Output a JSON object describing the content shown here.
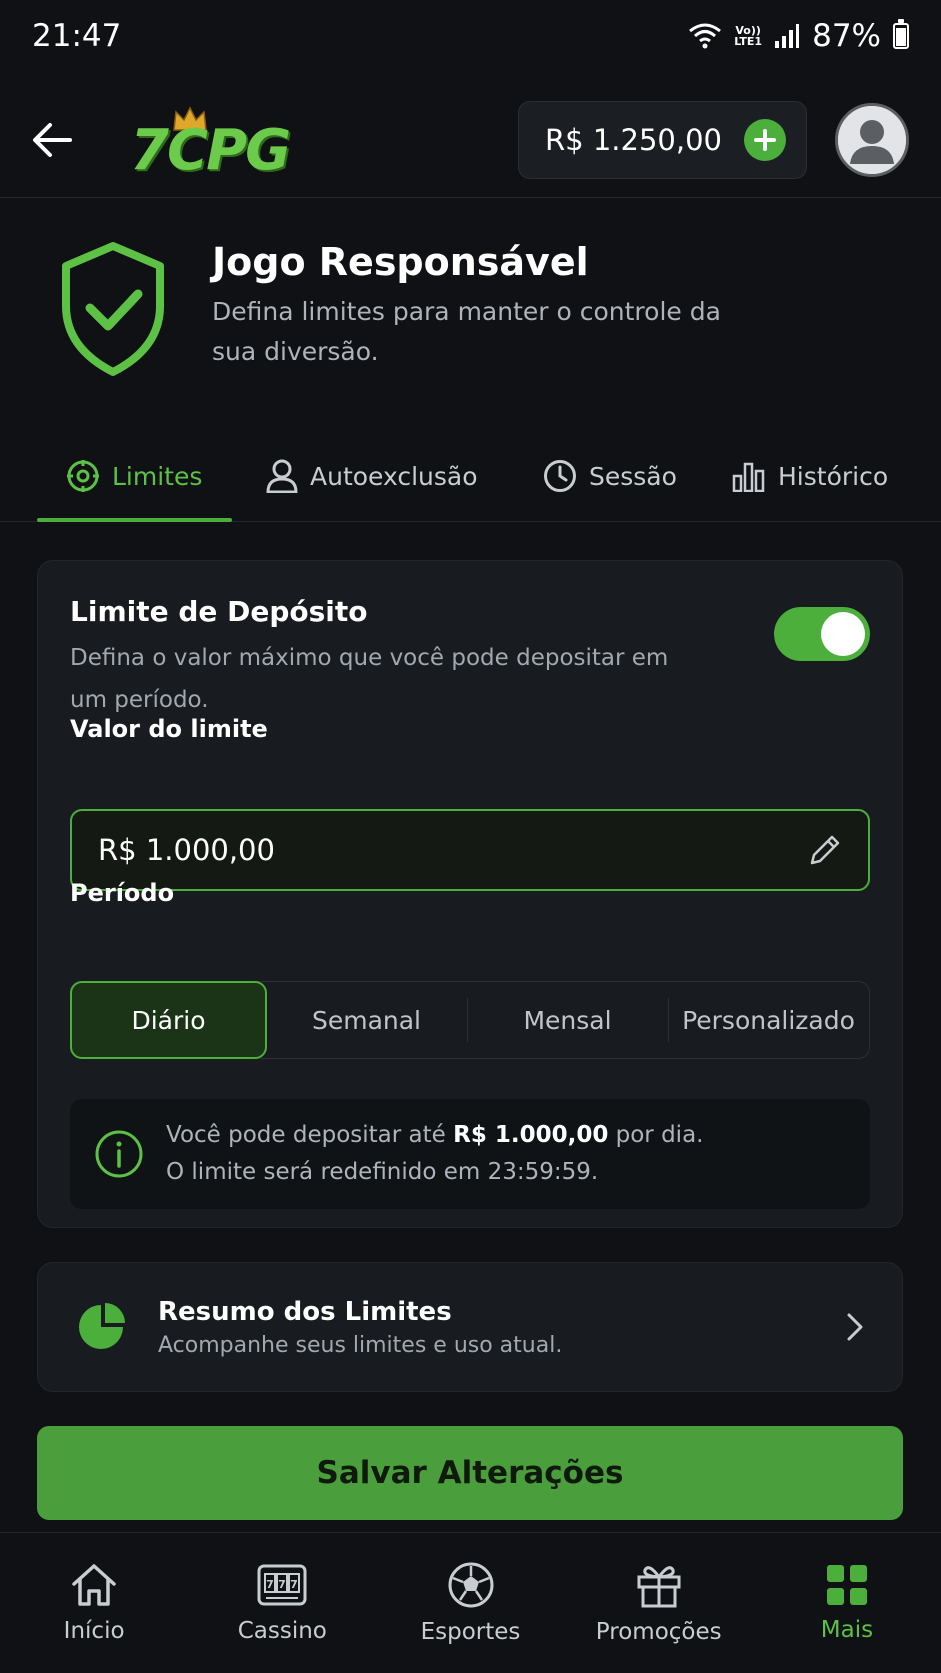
{
  "status_bar": {
    "time": "21:47",
    "network_top": "Vo))",
    "network_bottom": "LTE1",
    "battery": "87%"
  },
  "topbar": {
    "logo": "7CPG",
    "balance": "R$ 1.250,00"
  },
  "header": {
    "title": "Jogo Responsável",
    "subtitle": "Defina limites para manter o controle da sua diversão."
  },
  "tabs": [
    {
      "label": "Limites",
      "icon": "target-icon",
      "active": true
    },
    {
      "label": "Autoexclusão",
      "icon": "user-icon"
    },
    {
      "label": "Sessão",
      "icon": "clock-icon"
    },
    {
      "label": "Histórico",
      "icon": "bar-chart-icon"
    }
  ],
  "deposit_limit": {
    "title": "Limite de Depósito",
    "description": "Defina o valor máximo que você pode depositar em um período.",
    "enabled": true,
    "value_label": "Valor do limite",
    "value": "R$ 1.000,00",
    "period_label": "Período",
    "periods": [
      "Diário",
      "Semanal",
      "Mensal",
      "Personalizado"
    ],
    "selected_period": "Diário",
    "info_prefix": "Você pode depositar até ",
    "info_amount": "R$ 1.000,00",
    "info_suffix": " por dia.",
    "info_line2": "O limite será redefinido em 23:59:59."
  },
  "summary": {
    "title": "Resumo dos Limites",
    "subtitle": "Acompanhe seus limites e uso atual."
  },
  "save_label": "Salvar Alterações",
  "bottom_nav": [
    {
      "label": "Início",
      "icon": "home-icon"
    },
    {
      "label": "Cassino",
      "icon": "slot-machine-icon"
    },
    {
      "label": "Esportes",
      "icon": "soccer-ball-icon"
    },
    {
      "label": "Promoções",
      "icon": "gift-icon"
    },
    {
      "label": "Mais",
      "icon": "grid-icon",
      "active": true
    }
  ],
  "colors": {
    "accent": "#4caf3c",
    "background": "#0f1114",
    "card": "#181b1f"
  }
}
